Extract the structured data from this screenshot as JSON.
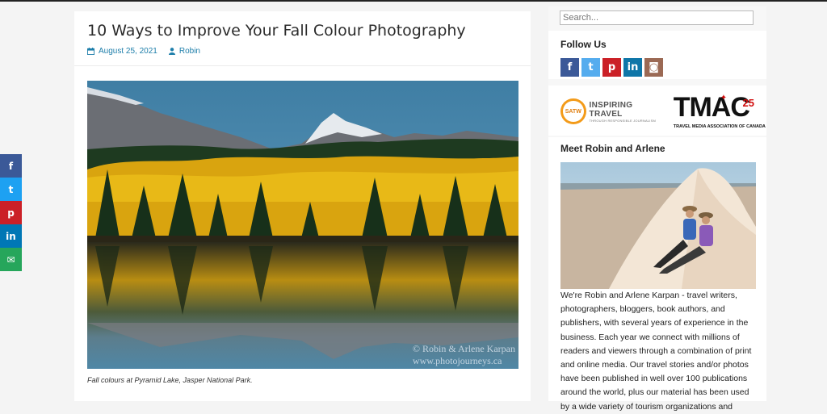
{
  "article": {
    "title": "10 Ways to Improve Your Fall Colour Photography",
    "date": "August 25, 2021",
    "author": "Robin",
    "caption": "Fall colours at Pyramid Lake, Jasper National Park.",
    "watermark_line1": "© Robin & Arlene Karpan",
    "watermark_line2": "www.photojourneys.ca"
  },
  "share": [
    {
      "name": "facebook",
      "glyph": "f"
    },
    {
      "name": "twitter",
      "glyph": "t"
    },
    {
      "name": "pinterest",
      "glyph": "p"
    },
    {
      "name": "linkedin",
      "glyph": "in"
    },
    {
      "name": "email",
      "glyph": "✉"
    }
  ],
  "sidebar": {
    "search_placeholder": "Search...",
    "follow_title": "Follow Us",
    "social": [
      {
        "name": "facebook",
        "glyph": "f",
        "color": "#3b5998"
      },
      {
        "name": "twitter",
        "glyph": "t",
        "color": "#55acee"
      },
      {
        "name": "pinterest",
        "glyph": "p",
        "color": "#cb2027"
      },
      {
        "name": "linkedin",
        "glyph": "in",
        "color": "#0e76a8"
      },
      {
        "name": "instagram",
        "glyph": "◙",
        "color": "#9b6954"
      }
    ],
    "satw_badge": "SATW",
    "satw_title": "INSPIRING TRAVEL",
    "satw_sub": "THROUGH RESPONSIBLE JOURNALISM",
    "tmac_word": "TMAC",
    "tmac_num": "25",
    "tmac_sub": "TRAVEL MEDIA ASSOCIATION OF CANADA",
    "meet_title": "Meet Robin and Arlene",
    "bio": "We're Robin and Arlene Karpan - travel writers, photographers, bloggers, book authors, and publishers, with several years of experience in the business. Each year we connect with millions of readers and viewers through a combination of print and online media. Our travel stories and/or photos have been published in well over 100 publications around the world, plus our material has been used by a wide variety of tourism organizations and"
  },
  "colors": {
    "link": "#1d7eaa"
  }
}
